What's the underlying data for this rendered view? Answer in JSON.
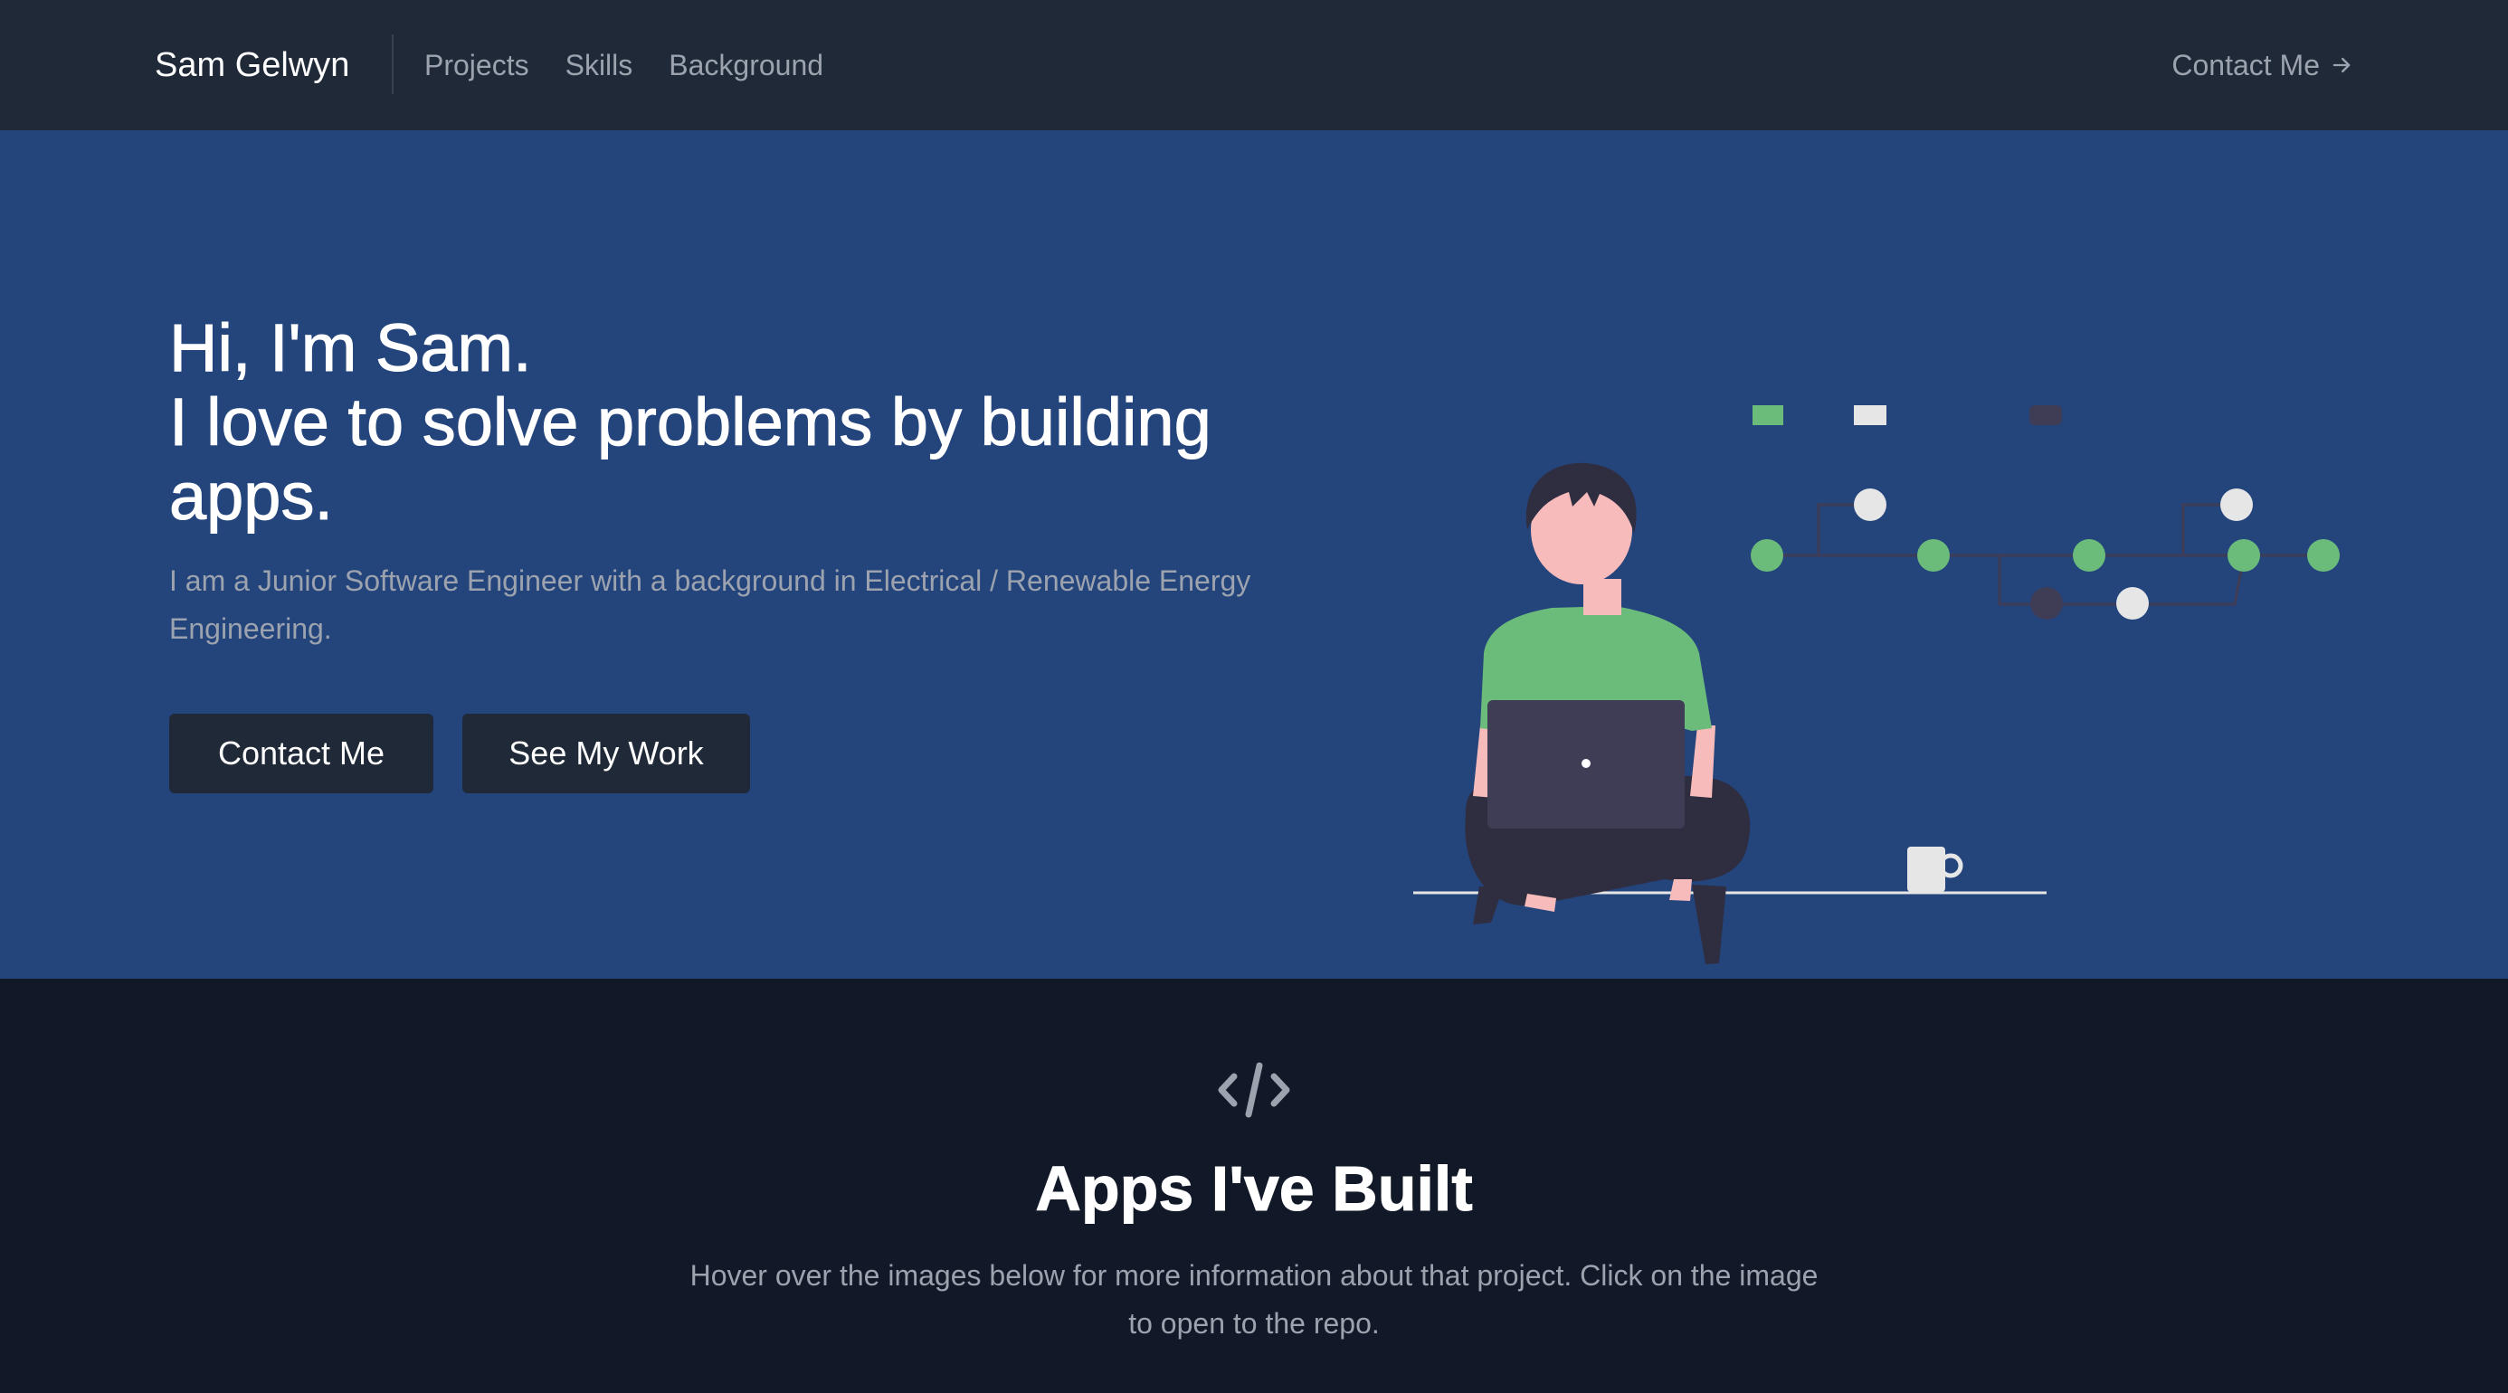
{
  "nav": {
    "brand": "Sam Gelwyn",
    "links": [
      "Projects",
      "Skills",
      "Background"
    ],
    "contact_label": "Contact Me",
    "contact_icon": "arrow-right-icon"
  },
  "hero": {
    "title_lines": [
      "Hi, I'm Sam.",
      "I love to solve problems by building",
      "apps."
    ],
    "subtitle": "I am a Junior Software Engineer with a background in Electrical / Renewable Energy Engineering.",
    "buttons": {
      "contact": "Contact Me",
      "work": "See My Work"
    },
    "illustration": "person-with-laptop-illustration"
  },
  "projects_section": {
    "icon": "code-icon",
    "title": "Apps I've Built",
    "subtitle": "Hover over the images below for more information about that project. Click on the image to open to the repo."
  },
  "colors": {
    "nav_bg": "#1f2937",
    "hero_bg": "#24447c",
    "section_bg": "#111827",
    "button_bg": "#1f2937",
    "muted_text": "#9ca3af",
    "accent_green": "#6bbb7b"
  }
}
